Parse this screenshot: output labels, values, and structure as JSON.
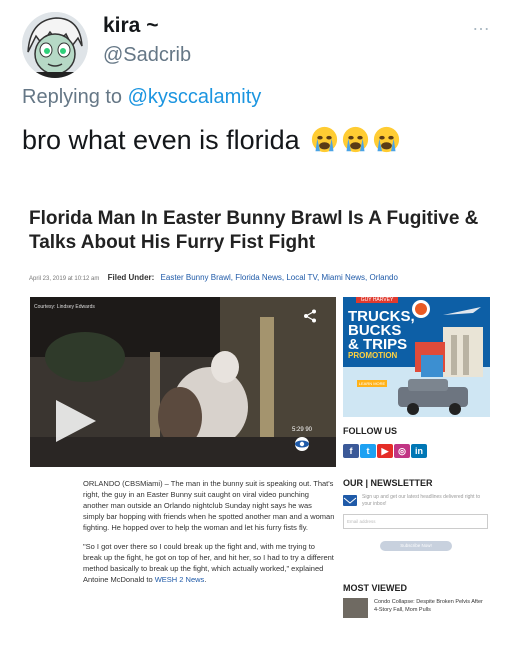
{
  "tweet": {
    "display_name": "kira ~",
    "handle": "@Sadcrib",
    "more_icon": "…",
    "replying_prefix": "Replying to",
    "replying_to": "@kysccalamity",
    "text": "bro what even is florida",
    "emoji": [
      "crying-face",
      "crying-face",
      "crying-face"
    ]
  },
  "article": {
    "headline": "Florida Man In Easter Bunny Brawl Is A Fugitive & Talks About His Furry Fist Fight",
    "date": "April 23, 2019 at 10:12 am",
    "filed_under_label": "Filed Under:",
    "tags": "Easter Bunny Brawl, Florida News, Local TV, Miami News, Orlando",
    "video": {
      "courtesy": "Courtesy: Lindsey Edwards",
      "timecode": "5:29 90",
      "network": "CBS"
    },
    "paragraph1": "ORLANDO (CBSMiami) – The man in the bunny suit is speaking out. That's right, the guy in an Easter Bunny suit caught on viral video punching another man outside an Orlando nightclub Sunday night says he was simply bar hopping with friends when he spotted another man and a woman fighting. He hopped over to help the woman and let his furry fists fly.",
    "paragraph2": "\"So I got over there so I could break up the fight and, with me trying to break up the fight, he got on top of her, and hit her, so I had to try a different method basically to break up the fight, which actually worked,\" explained Antoine McDonald to",
    "paragraph2_link": "WESH 2 News",
    "paragraph2_end": "."
  },
  "ad": {
    "brand": "GUY HARVEY",
    "line1": "TRUCKS,",
    "line2": "BUCKS",
    "line3": "& TRIPS",
    "promo": "PROMOTION",
    "cta": "LEARN MORE"
  },
  "sidebar": {
    "follow_us": "FOLLOW US",
    "social": [
      {
        "name": "facebook",
        "glyph": "f",
        "color": "#3b5998"
      },
      {
        "name": "twitter",
        "glyph": "t",
        "color": "#1da1f2"
      },
      {
        "name": "youtube",
        "glyph": "▶",
        "color": "#e52d27"
      },
      {
        "name": "instagram",
        "glyph": "◎",
        "color": "#c13584"
      },
      {
        "name": "linkedin",
        "glyph": "in",
        "color": "#0077b5"
      }
    ],
    "newsletter_title": "OUR | NEWSLETTER",
    "newsletter_desc": "Sign up and get our latest headlines delivered right to your inbox!",
    "email_placeholder": "Email address",
    "subscribe_label": "Subscribe Now!",
    "most_viewed_title": "MOST VIEWED",
    "most_viewed_item": "Condo Collapse: Despite Broken Pelvis After 4-Story Fall, Mom Pulls"
  },
  "colors": {
    "link_blue": "#1b95e0",
    "tag_blue": "#1f5aa8",
    "grey_text": "#657786"
  }
}
